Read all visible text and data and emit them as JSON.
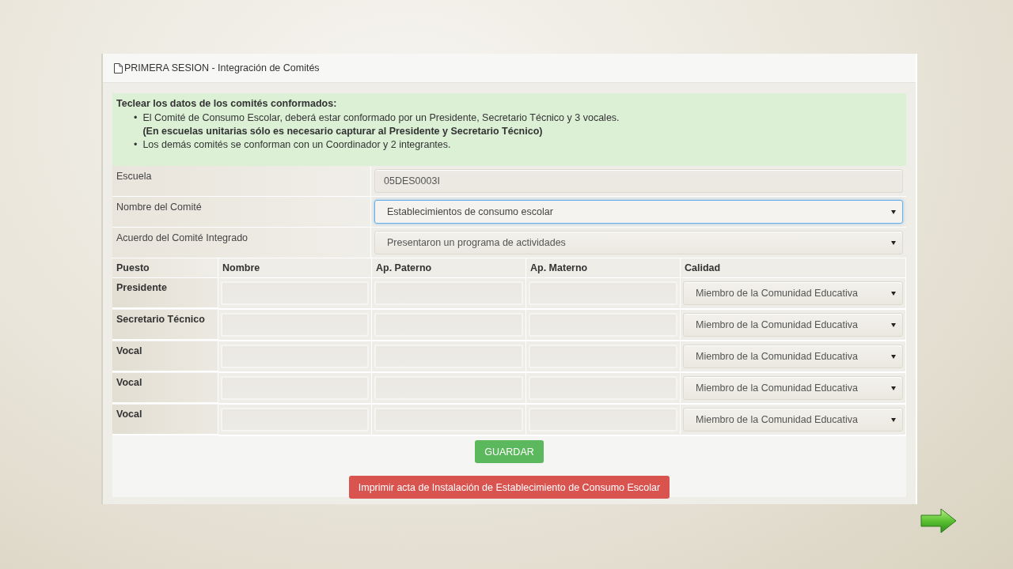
{
  "panel": {
    "title": "PRIMERA SESION - Integración de Comités"
  },
  "instructions": {
    "heading": "Teclear los datos de los comités conformados:",
    "items": [
      {
        "marker": "•",
        "text": "El Comité de Consumo Escolar, deberá estar conformado por un Presidente, Secretario Técnico y 3 vocales.",
        "note": "(En escuelas unitarias sólo es necesario capturar al Presidente y Secretario Técnico)"
      },
      {
        "marker": "•",
        "text": "Los demás comités se conforman con un Coordinador y 2 integrantes."
      }
    ]
  },
  "fields": [
    {
      "label": "Escuela",
      "kind": "readonly",
      "value": "05DES0003I",
      "focused": false
    },
    {
      "label": "Nombre del Comité",
      "kind": "select",
      "value": "Establecimientos de consumo escolar",
      "focused": true
    },
    {
      "label": "Acuerdo del Comité Integrado",
      "kind": "select",
      "value": "Presentaron un programa de actividades",
      "focused": false
    }
  ],
  "table": {
    "columns": [
      "Puesto",
      "Nombre",
      "Ap. Paterno",
      "Ap. Materno",
      "Calidad"
    ],
    "rows": [
      {
        "puesto": "Presidente",
        "calidad": "Miembro de la Comunidad Educativa"
      },
      {
        "puesto": "Secretario Técnico",
        "calidad": "Miembro de la Comunidad Educativa"
      },
      {
        "puesto": "Vocal",
        "calidad": "Miembro de la Comunidad Educativa"
      },
      {
        "puesto": "Vocal",
        "calidad": "Miembro de la Comunidad Educativa"
      },
      {
        "puesto": "Vocal",
        "calidad": "Miembro de la Comunidad Educativa"
      }
    ]
  },
  "buttons": [
    {
      "label": "GUARDAR",
      "kind": "success"
    },
    {
      "label": "Imprimir acta de Instalación de Establecimiento de Consumo Escolar",
      "kind": "danger"
    }
  ]
}
